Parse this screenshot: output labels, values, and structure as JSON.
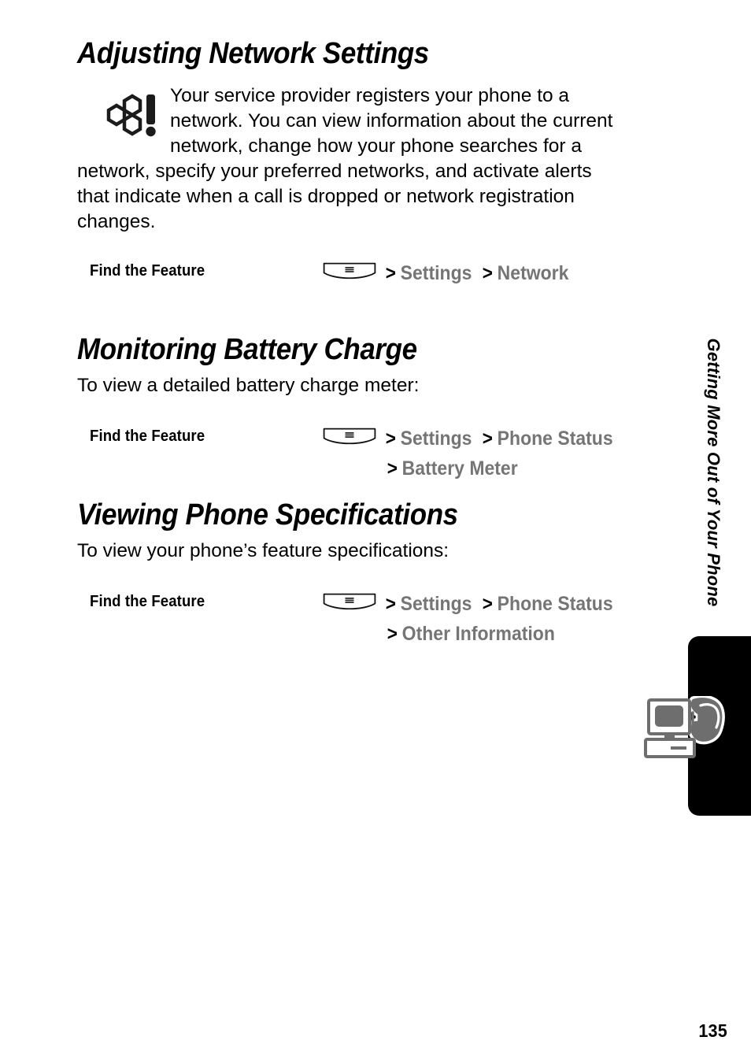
{
  "page": {
    "number": "135",
    "chapter_tab_label": "Getting More Out of Your Phone"
  },
  "sections": [
    {
      "id": "adjusting-network-settings",
      "title": "Adjusting Network Settings",
      "note": {
        "icon": "honeycomb-alert-icon",
        "lines": [
          "Your service provider registers your phone to a",
          "network. You can view information about the current",
          "network, change how your phone searches for a",
          "network, specify your preferred networks, and activate alerts",
          "that indicate when a call is dropped or network registration",
          "changes."
        ]
      },
      "find_the_feature": {
        "label": "Find the Feature",
        "key_icon": "menu-key-icon",
        "line1": {
          "sep1": ">",
          "item1": "Settings",
          "sep2": ">",
          "item2": "Network"
        }
      }
    },
    {
      "id": "monitoring-battery-charge",
      "title": "Monitoring Battery Charge",
      "intro": "To view a detailed battery charge meter:",
      "find_the_feature": {
        "label": "Find the Feature",
        "key_icon": "menu-key-icon",
        "line1": {
          "sep1": ">",
          "item1": "Settings",
          "sep2": ">",
          "item2": "Phone Status"
        },
        "line2": {
          "sep1": ">",
          "item1": "Battery Meter"
        }
      }
    },
    {
      "id": "viewing-phone-specifications",
      "title": "Viewing Phone Specifications",
      "intro": "To view your phone’s feature specifications:",
      "find_the_feature": {
        "label": "Find the Feature",
        "key_icon": "menu-key-icon",
        "line1": {
          "sep1": ">",
          "item1": "Settings",
          "sep2": ">",
          "item2": "Phone Status"
        },
        "line2": {
          "sep1": ">",
          "item1": "Other Information"
        }
      }
    }
  ],
  "thumb_tab": {
    "icon": "computer-phone-icon",
    "background_color": "#000000"
  },
  "colors": {
    "text": "#000000",
    "menu_path": "#757575",
    "tab_background": "#000000",
    "icon_gray": "#6e6e6e"
  }
}
